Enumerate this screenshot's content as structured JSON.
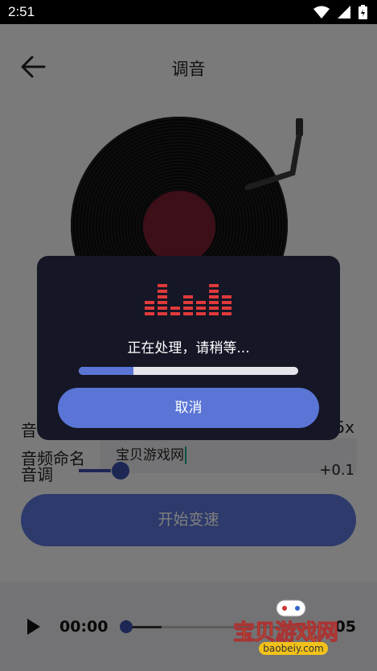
{
  "status_bar": {
    "time": "2:51"
  },
  "header": {
    "title": "调音"
  },
  "form": {
    "speed_label": "音",
    "speed_value": "5x",
    "name_label": "音频命名",
    "name_value": "宝贝游戏网",
    "pitch_label": "音调",
    "pitch_value": "+0.1",
    "start_button": "开始变速"
  },
  "player": {
    "current_time": "00:00",
    "total_time": "05",
    "progress": 0.0
  },
  "dialog": {
    "message": "正在处理，请稍等...",
    "progress_fraction": 0.25,
    "cancel_button": "取消"
  },
  "watermark": {
    "text": "宝贝游戏网",
    "url": "baobeiy.com"
  },
  "colors": {
    "accent": "#5a75d6",
    "dialog_bg": "#151626",
    "equalizer": "#e03a3a",
    "record_label": "#7a1f33"
  },
  "icons": {
    "back": "arrow-left-icon",
    "wifi": "wifi-icon",
    "signal": "signal-icon",
    "battery": "battery-icon",
    "equalizer": "equalizer-icon",
    "play": "play-icon"
  }
}
